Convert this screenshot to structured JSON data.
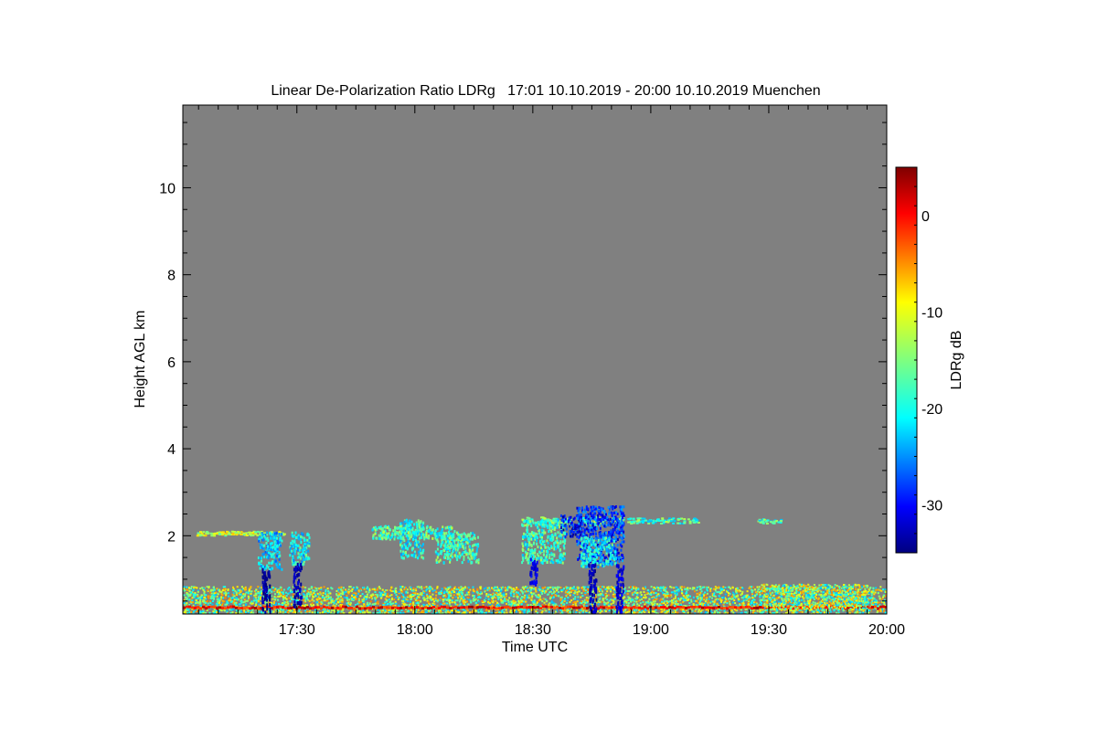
{
  "chart_data": {
    "type": "heatmap",
    "title": "Linear De-Polarization Ratio LDRg   17:01 10.10.2019 - 20:00 10.10.2019 Muenchen",
    "xlabel": "Time UTC",
    "ylabel": "Height AGL km",
    "colorbar_label": "LDRg dB",
    "x_range": [
      "17:01",
      "20:00"
    ],
    "xlim_minutes": [
      1021,
      1200
    ],
    "ylim": [
      0.2,
      11.9
    ],
    "clim": [
      -35,
      5
    ],
    "colormap": "jet",
    "background_color": "#808080",
    "x_ticks": [
      {
        "label": "17:30",
        "minute": 1050
      },
      {
        "label": "18:00",
        "minute": 1080
      },
      {
        "label": "18:30",
        "minute": 1110
      },
      {
        "label": "19:00",
        "minute": 1140
      },
      {
        "label": "19:30",
        "minute": 1170
      },
      {
        "label": "20:00",
        "minute": 1200
      }
    ],
    "y_ticks": [
      {
        "label": "2",
        "value": 2
      },
      {
        "label": "4",
        "value": 4
      },
      {
        "label": "6",
        "value": 6
      },
      {
        "label": "8",
        "value": 8
      },
      {
        "label": "10",
        "value": 10
      }
    ],
    "colorbar_ticks": [
      {
        "label": "0",
        "value": 0
      },
      {
        "label": "-10",
        "value": -10
      },
      {
        "label": "-20",
        "value": -20
      },
      {
        "label": "-30",
        "value": -30
      }
    ],
    "regions": [
      {
        "t0": 1021,
        "t1": 1200,
        "h0": 0.22,
        "h1": 0.85,
        "ldr": -14,
        "kind": "noise"
      },
      {
        "t0": 1021,
        "t1": 1200,
        "h0": 0.3,
        "h1": 0.4,
        "ldr": 0,
        "kind": "band"
      },
      {
        "t0": 1024,
        "t1": 1047,
        "h0": 2.02,
        "h1": 2.12,
        "ldr": -12,
        "kind": "layer"
      },
      {
        "t0": 1040,
        "t1": 1046,
        "h0": 1.25,
        "h1": 2.1,
        "ldr": -22,
        "kind": "cell"
      },
      {
        "t0": 1041,
        "t1": 1043,
        "h0": 0.25,
        "h1": 1.3,
        "ldr": -34,
        "kind": "fall"
      },
      {
        "t0": 1048,
        "t1": 1053,
        "h0": 1.35,
        "h1": 2.1,
        "ldr": -20,
        "kind": "cell"
      },
      {
        "t0": 1049,
        "t1": 1051,
        "h0": 0.4,
        "h1": 1.4,
        "ldr": -33,
        "kind": "fall"
      },
      {
        "t0": 1069,
        "t1": 1090,
        "h0": 1.95,
        "h1": 2.25,
        "ldr": -17,
        "kind": "cell"
      },
      {
        "t0": 1076,
        "t1": 1082,
        "h0": 1.5,
        "h1": 2.4,
        "ldr": -19,
        "kind": "cell"
      },
      {
        "t0": 1085,
        "t1": 1096,
        "h0": 1.4,
        "h1": 2.1,
        "ldr": -18,
        "kind": "cell"
      },
      {
        "t0": 1107,
        "t1": 1133,
        "h0": 2.25,
        "h1": 2.45,
        "ldr": -16,
        "kind": "layer"
      },
      {
        "t0": 1107,
        "t1": 1118,
        "h0": 1.4,
        "h1": 2.4,
        "ldr": -18,
        "kind": "cell"
      },
      {
        "t0": 1117,
        "t1": 1122,
        "h0": 2.0,
        "h1": 2.5,
        "ldr": -30,
        "kind": "cell"
      },
      {
        "t0": 1109,
        "t1": 1111,
        "h0": 0.9,
        "h1": 1.5,
        "ldr": -31,
        "kind": "fall"
      },
      {
        "t0": 1121,
        "t1": 1133,
        "h0": 1.4,
        "h1": 2.7,
        "ldr": -28,
        "kind": "cell"
      },
      {
        "t0": 1122,
        "t1": 1131,
        "h0": 1.3,
        "h1": 2.0,
        "ldr": -20,
        "kind": "cell"
      },
      {
        "t0": 1124,
        "t1": 1126,
        "h0": 0.25,
        "h1": 1.4,
        "ldr": -33,
        "kind": "fall"
      },
      {
        "t0": 1131,
        "t1": 1133,
        "h0": 0.25,
        "h1": 1.35,
        "ldr": -32,
        "kind": "fall"
      },
      {
        "t0": 1134,
        "t1": 1152,
        "h0": 2.3,
        "h1": 2.42,
        "ldr": -18,
        "kind": "layer"
      },
      {
        "t0": 1167,
        "t1": 1173,
        "h0": 2.3,
        "h1": 2.4,
        "ldr": -18,
        "kind": "layer"
      },
      {
        "t0": 1168,
        "t1": 1195,
        "h0": 0.3,
        "h1": 0.9,
        "ldr": -14,
        "kind": "noise"
      }
    ]
  }
}
